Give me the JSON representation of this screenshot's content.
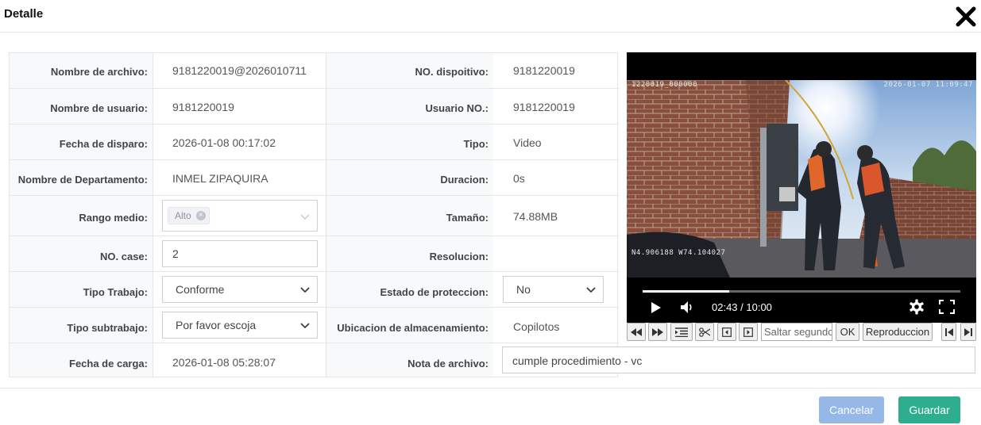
{
  "dialog": {
    "title": "Detalle"
  },
  "form": {
    "rows": [
      {
        "l1": "Nombre de archivo:",
        "v1": "9181220019@2026010711",
        "l2": "NO. dispoitivo:",
        "v2": "9181220019"
      },
      {
        "l1": "Nombre de usuario:",
        "v1": "9181220019",
        "l2": "Usuario NO.:",
        "v2": "9181220019"
      },
      {
        "l1": "Fecha de disparo:",
        "v1": "2026-01-08 00:17:02",
        "l2": "Tipo:",
        "v2": "Video"
      },
      {
        "l1": "Nombre de Departamento:",
        "v1": "INMEL ZIPAQUIRA",
        "l2": "Duracion:",
        "v2": "0s"
      },
      {
        "l1": "Rango medio:",
        "v1_tag": "Alto",
        "l2": "Tamaño:",
        "v2": "74.88MB"
      },
      {
        "l1": "NO. case:",
        "v1_input": "2",
        "l2": "Resolucion:",
        "v2": ""
      },
      {
        "l1": "Tipo Trabajo:",
        "v1_select": "Conforme",
        "l2": "Estado de proteccion:",
        "v2_select": "No"
      },
      {
        "l1": "Tipo subtrabajo:",
        "v1_select": "Por favor escoja",
        "l2": "Ubicacion de almacenamiento:",
        "v2": "Copilotos"
      },
      {
        "l1": "Fecha de carga:",
        "v1": "2026-01-08 05:28:07",
        "l2": "Nota de archivo:",
        "note": "cumple procedimiento - vc"
      }
    ]
  },
  "video": {
    "osd_top_left": "1220019_000000",
    "osd_top_right": "2026-01-07 11:09:47",
    "osd_gps": "N4.906188  W74.104027",
    "time": "02:43 / 10:00",
    "progress": 0.272
  },
  "toolbar": {
    "seek_placeholder": "Saltar segundo",
    "ok_label": "OK",
    "play_label": "Reproduccion"
  },
  "footer": {
    "cancel_label": "Cancelar",
    "save_label": "Guardar"
  },
  "colors": {
    "cancel": "#95b8e6",
    "save": "#2eae8e"
  }
}
